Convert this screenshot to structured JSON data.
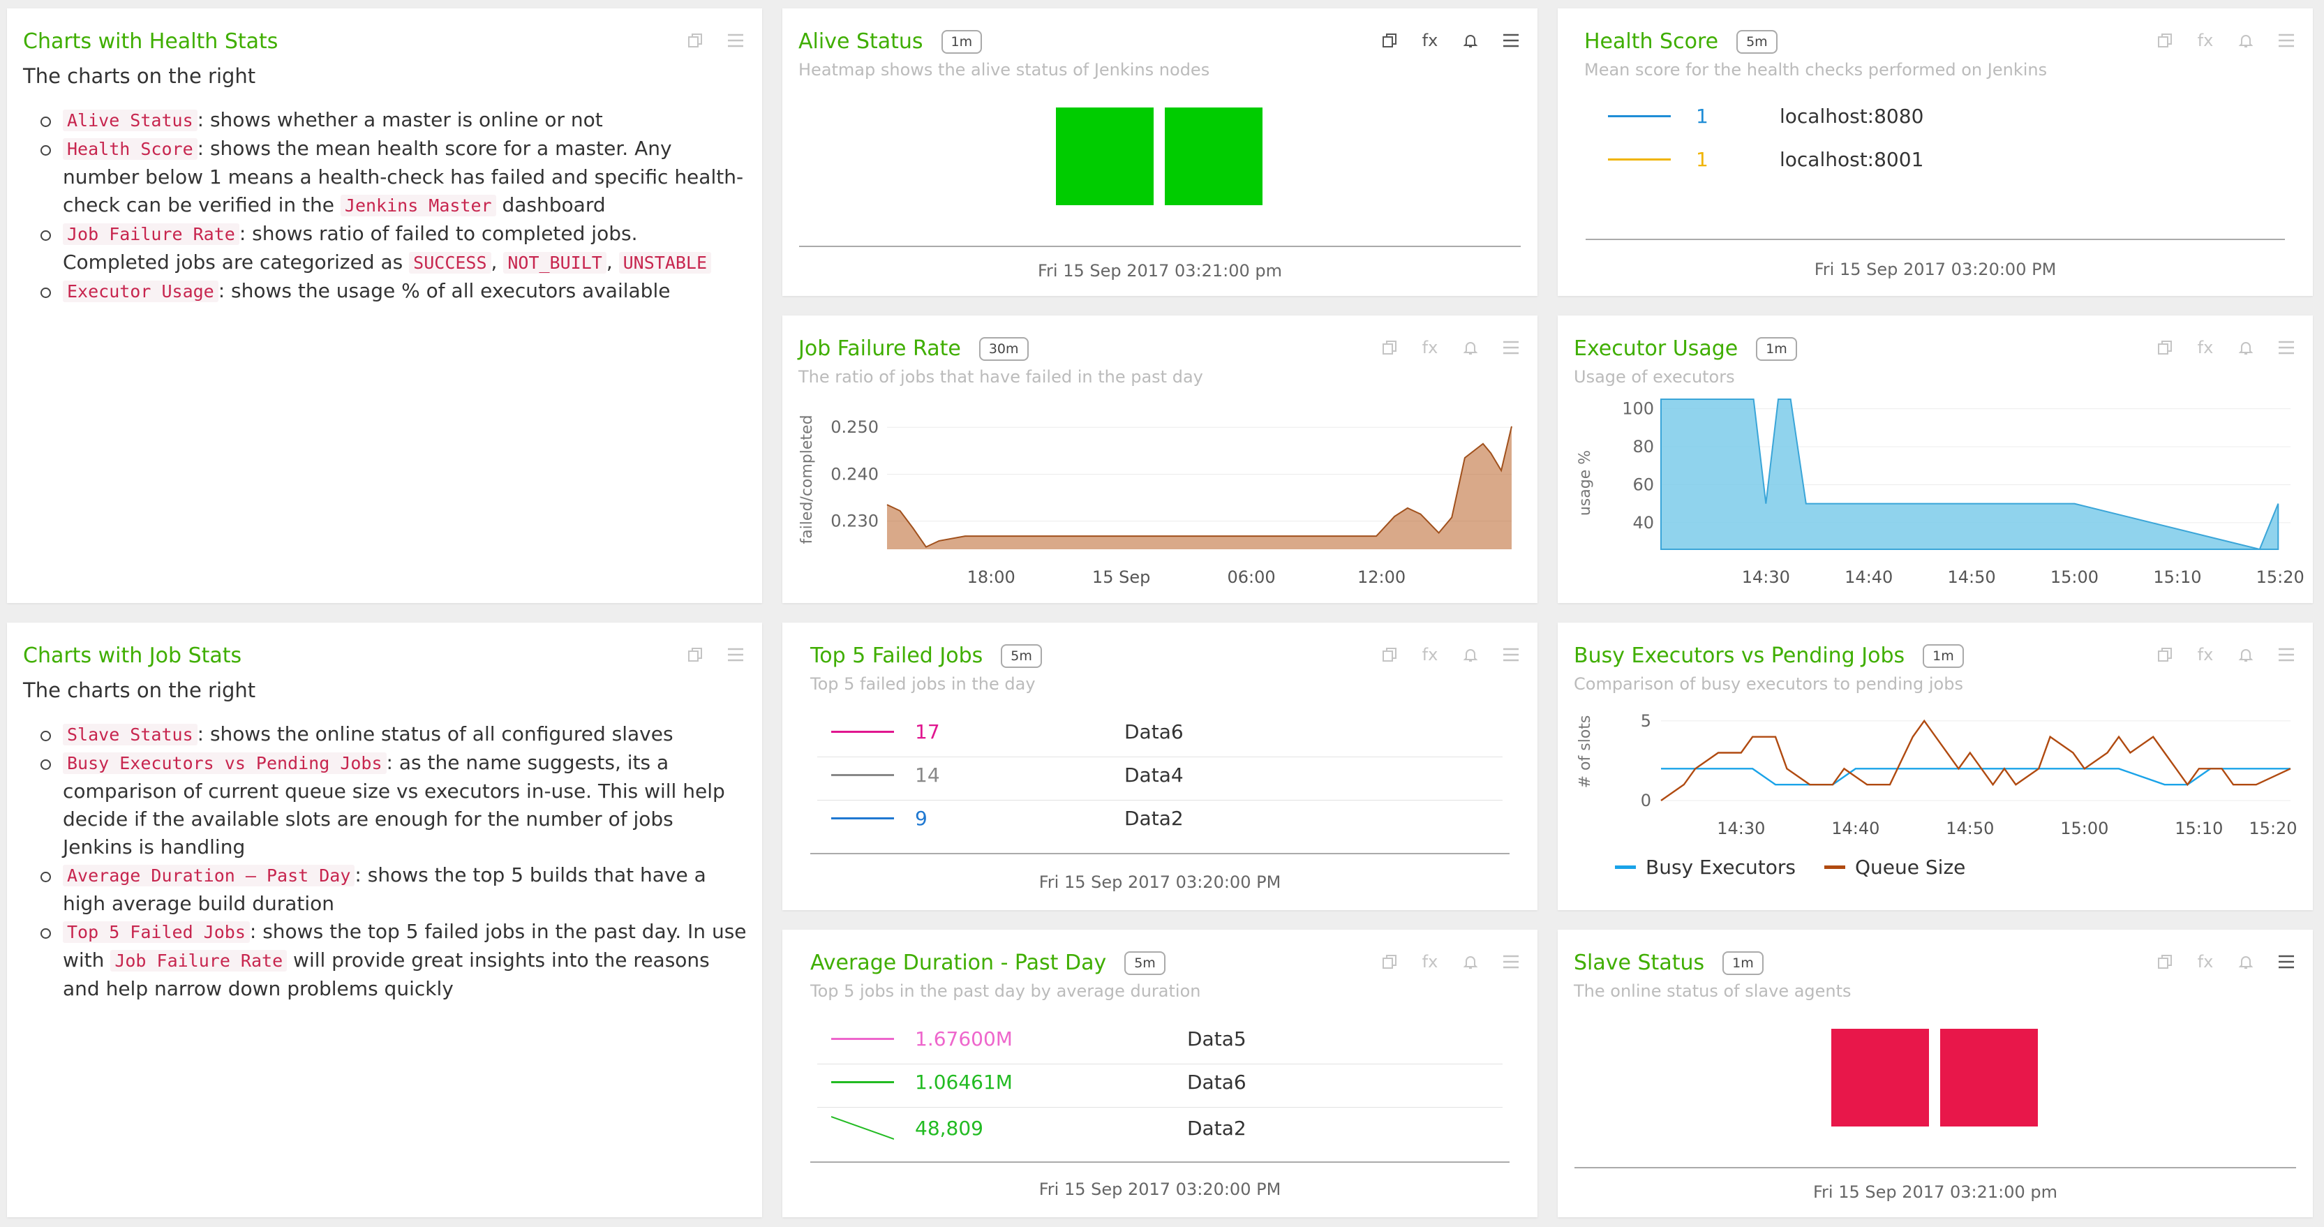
{
  "health_text": {
    "title": "Charts with Health Stats",
    "intro": "The charts on the right",
    "items": [
      {
        "code": "Alive Status",
        "text": ": shows whether a master is online or not"
      },
      {
        "code": "Health Score",
        "text_a": ": shows the mean health score for a master. Any number below 1 means a health-check has failed and specific health-check can be verified in the ",
        "code2": "Jenkins Master",
        "text_b": " dashboard"
      },
      {
        "code": "Job Failure Rate",
        "text_a": ": shows ratio of failed to completed jobs. Completed jobs are categorized as ",
        "c1": "SUCCESS",
        "c2": "NOT_BUILT",
        "c3": "UNSTABLE",
        "sep": ", "
      },
      {
        "code": "Executor Usage",
        "text": ": shows the usage % of all executors available"
      }
    ]
  },
  "job_text": {
    "title": "Charts with Job Stats",
    "intro": "The charts on the right",
    "items": [
      {
        "code": "Slave Status",
        "text": ": shows the online status of all configured slaves"
      },
      {
        "code": "Busy Executors vs Pending Jobs",
        "text": ": as the name suggests, its a comparison of current queue size vs executors in-use. This will help decide if the available slots are enough for the number of jobs Jenkins is handling"
      },
      {
        "code": "Average Duration – Past Day",
        "text": ": shows the top 5 builds that have a high average build duration"
      },
      {
        "code": "Top 5 Failed Jobs",
        "text_a": ": shows the top 5 failed jobs in the past day. In use with ",
        "code2": "Job Failure Rate",
        "text_b": " will provide great insights into the reasons and help narrow down problems quickly"
      }
    ]
  },
  "alive": {
    "title": "Alive Status",
    "badge": "1m",
    "subtitle": "Heatmap shows the alive status of Jenkins nodes",
    "time": "Fri 15 Sep 2017 03:21:00 pm",
    "color": "#00cc00"
  },
  "health": {
    "title": "Health Score",
    "badge": "5m",
    "subtitle": "Mean score for the health checks performed on Jenkins",
    "time": "Fri 15 Sep 2017 03:20:00 PM",
    "rows": [
      {
        "value": "1",
        "label": "localhost:8080",
        "color": "#1f8dd6"
      },
      {
        "value": "1",
        "label": "localhost:8001",
        "color": "#f0b400"
      }
    ]
  },
  "jobfail": {
    "title": "Job Failure Rate",
    "badge": "30m",
    "subtitle": "The ratio of jobs that have failed in the past day"
  },
  "executor": {
    "title": "Executor Usage",
    "badge": "1m",
    "subtitle": "Usage of executors"
  },
  "top5": {
    "title": "Top 5 Failed Jobs",
    "badge": "5m",
    "subtitle": "Top 5 failed jobs in the day",
    "time": "Fri 15 Sep 2017 03:20:00 PM",
    "rows": [
      {
        "value": "17",
        "label": "Data6",
        "color": "#e0168f"
      },
      {
        "value": "14",
        "label": "Data4",
        "color": "#888888"
      },
      {
        "value": "9",
        "label": "Data2",
        "color": "#1f78d1"
      }
    ]
  },
  "busy": {
    "title": "Busy Executors vs Pending Jobs",
    "badge": "1m",
    "subtitle": "Comparison of busy executors to pending jobs"
  },
  "avgdur": {
    "title": "Average Duration - Past Day",
    "badge": "5m",
    "subtitle": "Top 5 jobs in the past day by average duration",
    "time": "Fri 15 Sep 2017 03:20:00 PM",
    "rows": [
      {
        "value": "1.67600M",
        "label": "Data5",
        "color": "#ee66cc"
      },
      {
        "value": "1.06461M",
        "label": "Data6",
        "color": "#22bb22"
      },
      {
        "value": "48,809",
        "label": "Data2",
        "color": "#22bb22"
      }
    ]
  },
  "slave": {
    "title": "Slave Status",
    "badge": "1m",
    "subtitle": "The online status of slave agents",
    "time": "Fri 15 Sep 2017 03:21:00 pm",
    "color": "#e8174a"
  },
  "chart_data": [
    {
      "id": "job_failure_rate",
      "type": "area",
      "ylabel": "failed/completed",
      "x_ticks": [
        "18:00",
        "15 Sep",
        "06:00",
        "12:00"
      ],
      "y_ticks": [
        "0.250",
        "0.240",
        "0.230"
      ],
      "ylim": [
        0.224,
        0.2545
      ],
      "x_range": [
        0,
        24
      ],
      "color": "#c0703a",
      "x": [
        0,
        0.5,
        1,
        1.5,
        2,
        3,
        5,
        8,
        11,
        14,
        16,
        17,
        18.8,
        19.5,
        20,
        20.5,
        21.2,
        21.7,
        22.2,
        22.9,
        23.2,
        23.6,
        24
      ],
      "y": [
        0.2335,
        0.2322,
        0.2285,
        0.2245,
        0.2258,
        0.2268,
        0.2268,
        0.2268,
        0.2268,
        0.2268,
        0.2268,
        0.2268,
        0.2268,
        0.231,
        0.2328,
        0.2315,
        0.2275,
        0.2308,
        0.2435,
        0.2465,
        0.2445,
        0.2408,
        0.2502
      ]
    },
    {
      "id": "executor_usage",
      "type": "area",
      "ylabel": "usage %",
      "x_ticks": [
        "14:30",
        "14:40",
        "14:50",
        "15:00",
        "15:10",
        "15:20"
      ],
      "y_ticks": [
        "100",
        "80",
        "60",
        "40"
      ],
      "ylim": [
        26,
        105
      ],
      "x_range": [
        14.33,
        15.35
      ],
      "color": "#7ccbea",
      "x": [
        14.33,
        14.48,
        14.5,
        14.52,
        14.54,
        14.565,
        14.57,
        14.595,
        15.0,
        15.3,
        15.33
      ],
      "y": [
        105,
        105,
        50,
        105,
        105,
        50,
        50,
        50,
        50,
        26,
        50
      ]
    },
    {
      "id": "busy_vs_pending",
      "type": "line",
      "ylabel": "# of slots",
      "x_ticks": [
        "14:30",
        "14:40",
        "14:50",
        "15:00",
        "15:10",
        "15:20"
      ],
      "y_ticks": [
        "5",
        "0"
      ],
      "ylim": [
        0,
        6
      ],
      "legend": "bottom",
      "series": [
        {
          "name": "Busy Executors",
          "color": "#1aa3e8",
          "x": [
            0,
            5,
            8,
            10,
            15,
            17,
            20,
            25,
            40,
            44,
            46,
            48,
            50,
            55
          ],
          "y": [
            2,
            2,
            2,
            1,
            1,
            2,
            2,
            2,
            2,
            1,
            1,
            2,
            2,
            2
          ]
        },
        {
          "name": "Queue Size",
          "color": "#b04a10",
          "x": [
            0,
            2,
            3,
            5,
            7,
            8,
            10,
            11,
            13,
            15,
            16,
            18,
            20,
            22,
            23,
            24,
            26,
            27,
            29,
            30,
            31,
            33,
            34,
            36,
            37,
            39,
            40,
            41,
            43,
            44,
            45,
            46,
            47,
            49,
            50,
            52,
            55
          ],
          "y": [
            0,
            1,
            2,
            3,
            3,
            4,
            4,
            2,
            1,
            1,
            2,
            1,
            1,
            4,
            5,
            4,
            2,
            3,
            1,
            2,
            1,
            2,
            4,
            3,
            2,
            3,
            4,
            3,
            4,
            3,
            2,
            1,
            2,
            2,
            1,
            1,
            2
          ]
        }
      ]
    },
    {
      "id": "alive_status",
      "type": "heatmap",
      "values": [
        1,
        1
      ]
    },
    {
      "id": "slave_status",
      "type": "heatmap",
      "values": [
        0,
        0
      ]
    }
  ]
}
